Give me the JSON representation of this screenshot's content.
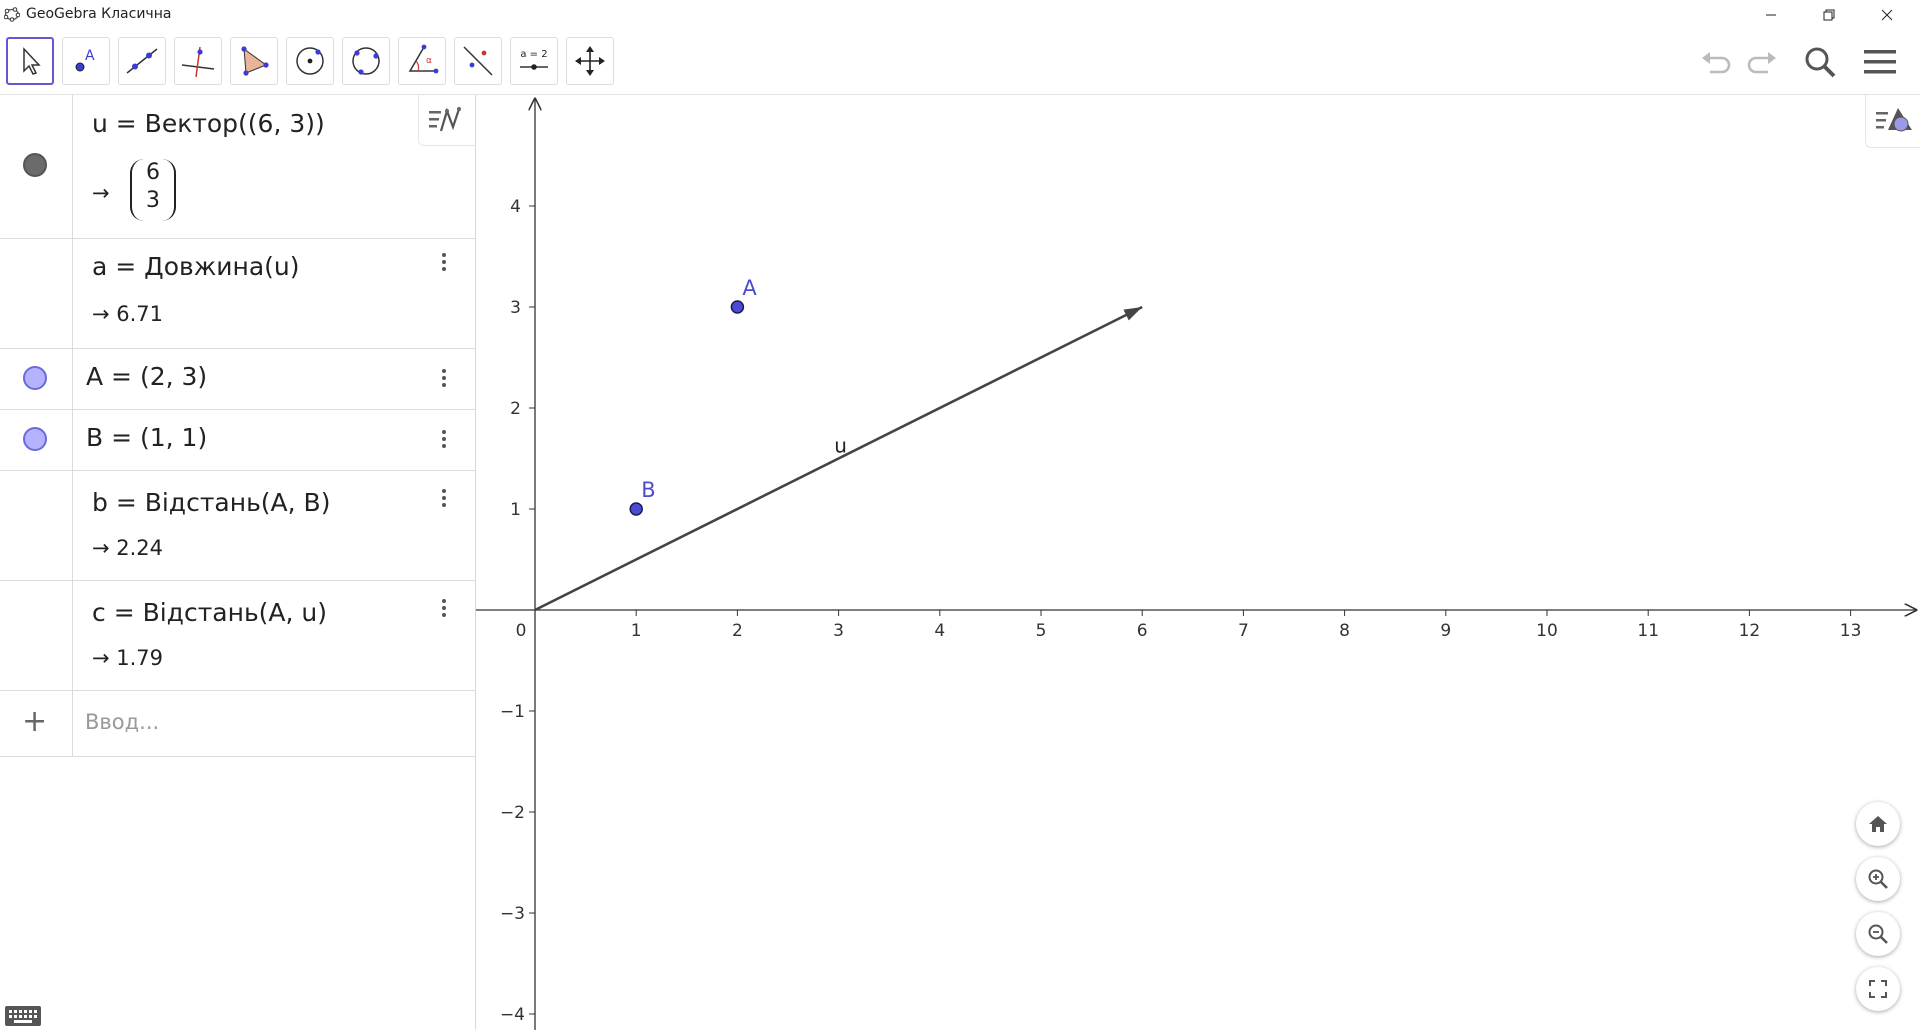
{
  "window": {
    "title": "GeoGebra Класична"
  },
  "toolbar": {
    "tools": [
      "move-tool",
      "point-tool",
      "line-tool",
      "perpendicular-line-tool",
      "polygon-tool",
      "circle-center-point-tool",
      "circle-three-points-tool",
      "angle-tool",
      "reflect-about-line-tool",
      "slider-tool",
      "move-graphics-view-tool"
    ],
    "slider_label": "a = 2"
  },
  "algebra": {
    "rows": [
      {
        "definition": "u = Вектор((6, 3))",
        "vector": [
          "6",
          "3"
        ],
        "marble": "grey"
      },
      {
        "definition": "a = Довжина(u)",
        "output": "→ 6.71"
      },
      {
        "definition": "A = (2, 3)",
        "marble": "blue"
      },
      {
        "definition": "B = (1, 1)",
        "marble": "blue"
      },
      {
        "definition": "b = Відстань(A, B)",
        "output": "→ 2.24"
      },
      {
        "definition": "c = Відстань(A, u)",
        "output": "→ 1.79"
      }
    ],
    "input_placeholder": "Ввод..."
  },
  "graphics": {
    "x_ticks": [
      "0",
      "1",
      "2",
      "3",
      "4",
      "5",
      "6",
      "7",
      "8",
      "9",
      "10",
      "11",
      "12",
      "13"
    ],
    "y_ticks_positive": [
      "1",
      "2",
      "3",
      "4"
    ],
    "y_ticks_negative": [
      "−1",
      "−2",
      "−3",
      "−4"
    ],
    "point_color": "#4c4ccf",
    "vector_color": "#444444",
    "objects": {
      "vector": {
        "label": "u",
        "from": [
          0,
          0
        ],
        "to": [
          6,
          3
        ]
      },
      "points": [
        {
          "label": "A",
          "x": 2,
          "y": 3
        },
        {
          "label": "B",
          "x": 1,
          "y": 1
        }
      ]
    }
  },
  "colors": {
    "accent": "#6557d2",
    "point_fill": "#4c4ccf",
    "marble_blue": "#b3b3ff"
  }
}
